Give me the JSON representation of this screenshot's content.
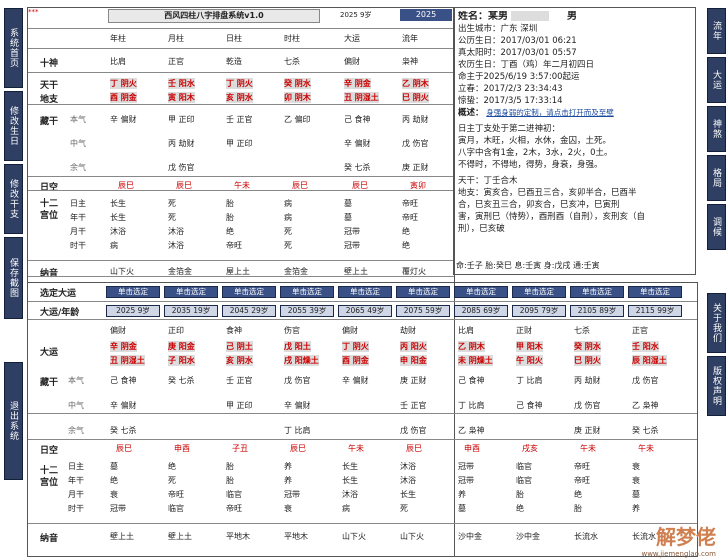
{
  "app": {
    "title": "西风四柱八字排盘系统v1.0",
    "year_label": "2025 9岁",
    "year_button": "2025"
  },
  "left_nav": [
    "系统首页",
    "修改生日",
    "修改干支",
    "保存截图",
    "退出系统"
  ],
  "right_nav": [
    "流年",
    "大运",
    "神煞",
    "格局",
    "调候",
    "关于我们",
    "版权声明"
  ],
  "pillars": {
    "headers": [
      "年柱",
      "月柱",
      "日柱",
      "时柱",
      "大运",
      "流年"
    ],
    "shishen": [
      "比肩",
      "正官",
      "乾造",
      "七杀",
      "偏财",
      "枭神"
    ],
    "tiangan": [
      [
        "丁",
        "阴火"
      ],
      [
        "壬",
        "阳水"
      ],
      [
        "丁",
        "阴火"
      ],
      [
        "癸",
        "阴水"
      ],
      [
        "辛",
        "阴金"
      ],
      [
        "乙",
        "阴木"
      ]
    ],
    "dizhi": [
      [
        "酉",
        "阴金"
      ],
      [
        "寅",
        "阳木"
      ],
      [
        "亥",
        "阴水"
      ],
      [
        "卯",
        "阴木"
      ],
      [
        "丑",
        "阴湿土"
      ],
      [
        "巳",
        "阴火"
      ]
    ],
    "canggan_ben": [
      "辛 偏财",
      "甲 正印",
      "壬 正官",
      "乙 偏印",
      "己 食神",
      "丙 劫财"
    ],
    "canggan_zhong": [
      "",
      "丙 劫财",
      "甲 正印",
      "",
      "辛 偏财",
      "戊 伤官"
    ],
    "canggan_yu": [
      "",
      "戊 伤官",
      "",
      "",
      "癸 七杀",
      "庚 正财"
    ],
    "kongwang": [
      "辰巳",
      "辰巳",
      "午未",
      "辰巳",
      "辰巳",
      "寅卯"
    ],
    "gongwei_labels": [
      "日主",
      "年干",
      "月干",
      "时干"
    ],
    "gongwei": [
      [
        "长生",
        "长生",
        "沐浴",
        "病"
      ],
      [
        "死",
        "死",
        "沐浴",
        "沐浴"
      ],
      [
        "胎",
        "胎",
        "绝",
        "帝旺"
      ],
      [
        "病",
        "病",
        "死",
        "死"
      ],
      [
        "墓",
        "墓",
        "冠带",
        "冠带"
      ],
      [
        "帝旺",
        "帝旺",
        "绝",
        "绝"
      ]
    ],
    "nayin": [
      "山下火",
      "金箔金",
      "屋上土",
      "金箔金",
      "壁上土",
      "覆灯火"
    ],
    "minggong": "命:壬子 胎:癸巳 息:壬寅 身:戊戌 通:壬寅"
  },
  "labels": {
    "shishen": "十神",
    "tiangan": "天干",
    "dizhi": "地支",
    "canggan": "藏干",
    "ben": "本气",
    "zhong": "中气",
    "yu": "余气",
    "kongwang": "日空",
    "gongwei": "十二宫位",
    "nayin": "纳音",
    "xuanding": "选定大运",
    "dayun_liunian": "大运/年龄",
    "dayun": "大运"
  },
  "right_info": {
    "name_label": "姓名：某男",
    "gender": "男",
    "lines": [
      "出生城市：广东 深圳",
      "公历生日：2017/03/01 06:21",
      "真太阳时：2017/03/01 05:57",
      "农历生日：丁酉（鸡）年二月初四日",
      "命主于2025/6/19 3:57:00起运",
      "立春：2017/2/3 23:34:43",
      "惊蛰：2017/3/5 17:33:14"
    ],
    "gaishu_label": "概述：",
    "gaishu": "身强身弱的定制，请点击打开而及至壁",
    "text1": [
      "日主丁支处于第二进神初：",
      "寅月，木旺，火相，水休，金囚，土死。",
      "八字中含有1金，2木，3水，2火，0土。",
      "不得时，不得地，得势，身衰，身强。"
    ],
    "tiangan_he": "天干：丁壬合木",
    "dizhi_rel": [
      "地支：寅亥合，巳酉丑三合，亥卯半合，巳酉半",
      "合，巳亥丑三合，卯亥合，巳亥冲，巳寅刑",
      "害，寅刑巳（恃势），酉刑酉（自刑），亥刑亥（自",
      "刑），巳亥破"
    ]
  },
  "dayun_buttons": [
    "单击选定",
    "单击选定",
    "单击选定",
    "单击选定",
    "单击选定",
    "单击选定",
    "单击选定",
    "单击选定",
    "单击选定",
    "单击选定"
  ],
  "dayun_years": [
    "2025 9岁",
    "2035 19岁",
    "2045 29岁",
    "2055 39岁",
    "2065 49岁",
    "2075 59岁",
    "2085 69岁",
    "2095 79岁",
    "2105 89岁",
    "2115 99岁"
  ],
  "dayun": {
    "shishen": [
      "偏财",
      "正印",
      "食神",
      "伤官",
      "偏财",
      "劫财",
      "比肩",
      "正财",
      "七杀",
      "正官"
    ],
    "tiangan": [
      [
        "辛",
        "阴金"
      ],
      [
        "庚",
        "阳金"
      ],
      [
        "己",
        "阴土"
      ],
      [
        "戊",
        "阳土"
      ],
      [
        "丁",
        "阴火"
      ],
      [
        "丙",
        "阳火"
      ],
      [
        "乙",
        "阴木"
      ],
      [
        "甲",
        "阳木"
      ],
      [
        "癸",
        "阴水"
      ],
      [
        "壬",
        "阳水"
      ]
    ],
    "dizhi": [
      [
        "丑",
        "阴湿土"
      ],
      [
        "子",
        "阳水"
      ],
      [
        "亥",
        "阴水"
      ],
      [
        "戌",
        "阳燥土"
      ],
      [
        "酉",
        "阴金"
      ],
      [
        "申",
        "阳金"
      ],
      [
        "未",
        "阴燥土"
      ],
      [
        "午",
        "阳火"
      ],
      [
        "巳",
        "阴火"
      ],
      [
        "辰",
        "阳湿土"
      ]
    ],
    "ben": [
      "己 食神",
      "癸 七杀",
      "壬 正官",
      "戊 伤官",
      "辛 偏财",
      "庚 正财",
      "己 食神",
      "丁 比肩",
      "丙 劫财",
      "戊 伤官"
    ],
    "zhong": [
      "辛 偏财",
      "",
      "甲 正印",
      "辛 偏财",
      "",
      "壬 正官",
      "丁 比肩",
      "己 食神",
      "戊 伤官",
      "乙 枭神"
    ],
    "yu": [
      "癸 七杀",
      "",
      "",
      "丁 比肩",
      "",
      "戊 伤官",
      "乙 枭神",
      "",
      "庚 正财",
      "癸 七杀"
    ],
    "kongwang": [
      "辰巳",
      "申酉",
      "子丑",
      "辰巳",
      "午未",
      "辰巳",
      "申酉",
      "戌亥",
      "午未",
      "午未"
    ],
    "gongwei": [
      [
        "墓",
        "绝",
        "胎",
        "养",
        "长生",
        "沐浴",
        "冠带",
        "临官",
        "帝旺",
        "衰"
      ],
      [
        "绝",
        "死",
        "胎",
        "养",
        "长生",
        "沐浴",
        "冠带",
        "临官",
        "帝旺",
        "衰"
      ],
      [
        "衰",
        "帝旺",
        "临官",
        "冠带",
        "沐浴",
        "长生",
        "养",
        "胎",
        "绝",
        "墓"
      ],
      [
        "冠带",
        "临官",
        "帝旺",
        "衰",
        "病",
        "死",
        "墓",
        "绝",
        "胎",
        "养"
      ]
    ],
    "nayin": [
      "壁上土",
      "壁上土",
      "平地木",
      "平地木",
      "山下火",
      "山下火",
      "沙中金",
      "沙中金",
      "长流水",
      "长流水"
    ]
  },
  "watermark": {
    "title": "解梦佬",
    "url": "www.jiemenglao.com"
  }
}
